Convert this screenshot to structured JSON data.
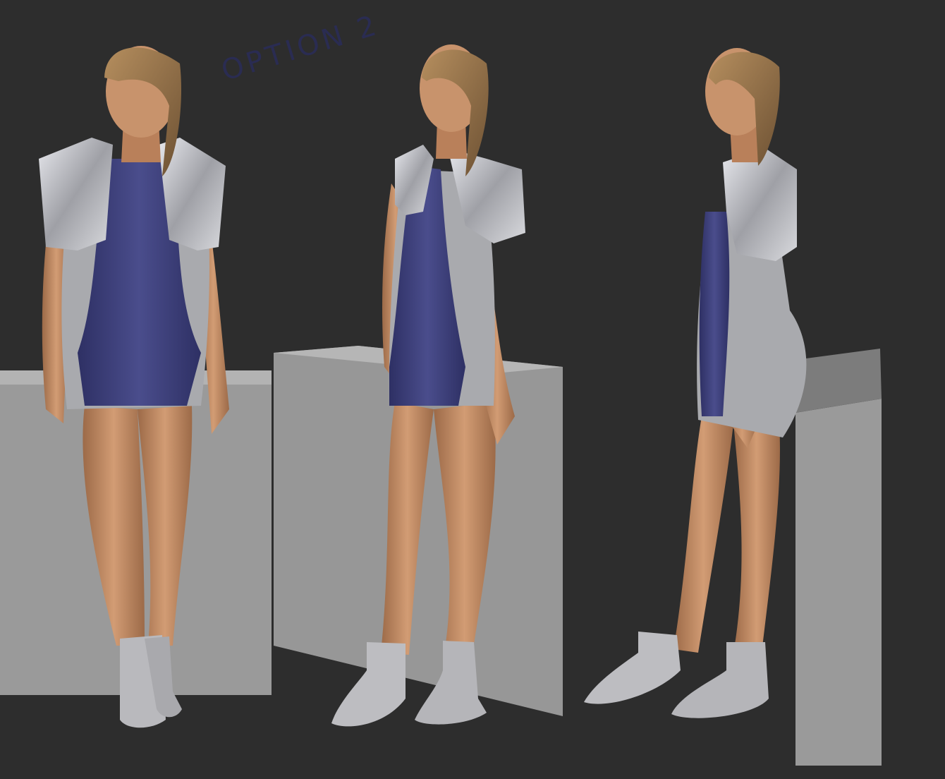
{
  "annotation": {
    "text": "OPTION 2"
  },
  "colors": {
    "background": "#2d2d2d",
    "block_light": "#a6a6a6",
    "block_mid": "#8e8e8e",
    "skin": "#c8936c",
    "skin_shadow": "#9c6a48",
    "dress_blue": "#3d3f7a",
    "dress_silver": "#a9aaae",
    "jacket_silver": "#c9cacf",
    "hair": "#8b6a44",
    "boots": "#b9b9bd",
    "annotation_ink": "#2a2c52"
  }
}
